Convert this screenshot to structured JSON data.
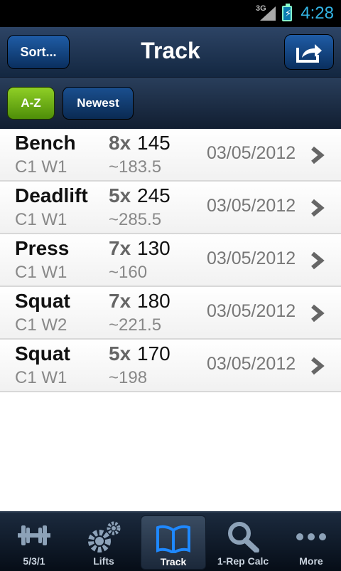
{
  "status_bar": {
    "network": "3G",
    "time": "4:28",
    "accent_color": "#33b5e5"
  },
  "header": {
    "sort_label": "Sort...",
    "title": "Track",
    "share_icon": "share-icon"
  },
  "filters": {
    "az_label": "A-Z",
    "newest_label": "Newest",
    "active": "A-Z",
    "active_color": "#6fb11b"
  },
  "entries": [
    {
      "lift": "Bench",
      "cycle": "C1 W1",
      "reps": "8x",
      "weight": "145",
      "estimate": "~183.5",
      "date": "03/05/2012"
    },
    {
      "lift": "Deadlift",
      "cycle": "C1 W1",
      "reps": "5x",
      "weight": "245",
      "estimate": "~285.5",
      "date": "03/05/2012"
    },
    {
      "lift": "Press",
      "cycle": "C1 W1",
      "reps": "7x",
      "weight": "130",
      "estimate": "~160",
      "date": "03/05/2012"
    },
    {
      "lift": "Squat",
      "cycle": "C1 W2",
      "reps": "7x",
      "weight": "180",
      "estimate": "~221.5",
      "date": "03/05/2012"
    },
    {
      "lift": "Squat",
      "cycle": "C1 W1",
      "reps": "5x",
      "weight": "170",
      "estimate": "~198",
      "date": "03/05/2012"
    }
  ],
  "tabs": [
    {
      "label": "5/3/1",
      "icon": "barbell-icon"
    },
    {
      "label": "Lifts",
      "icon": "gears-icon"
    },
    {
      "label": "Track",
      "icon": "book-icon"
    },
    {
      "label": "1-Rep Calc",
      "icon": "magnifier-icon"
    },
    {
      "label": "More",
      "icon": "more-dots-icon"
    }
  ],
  "active_tab": "Track"
}
